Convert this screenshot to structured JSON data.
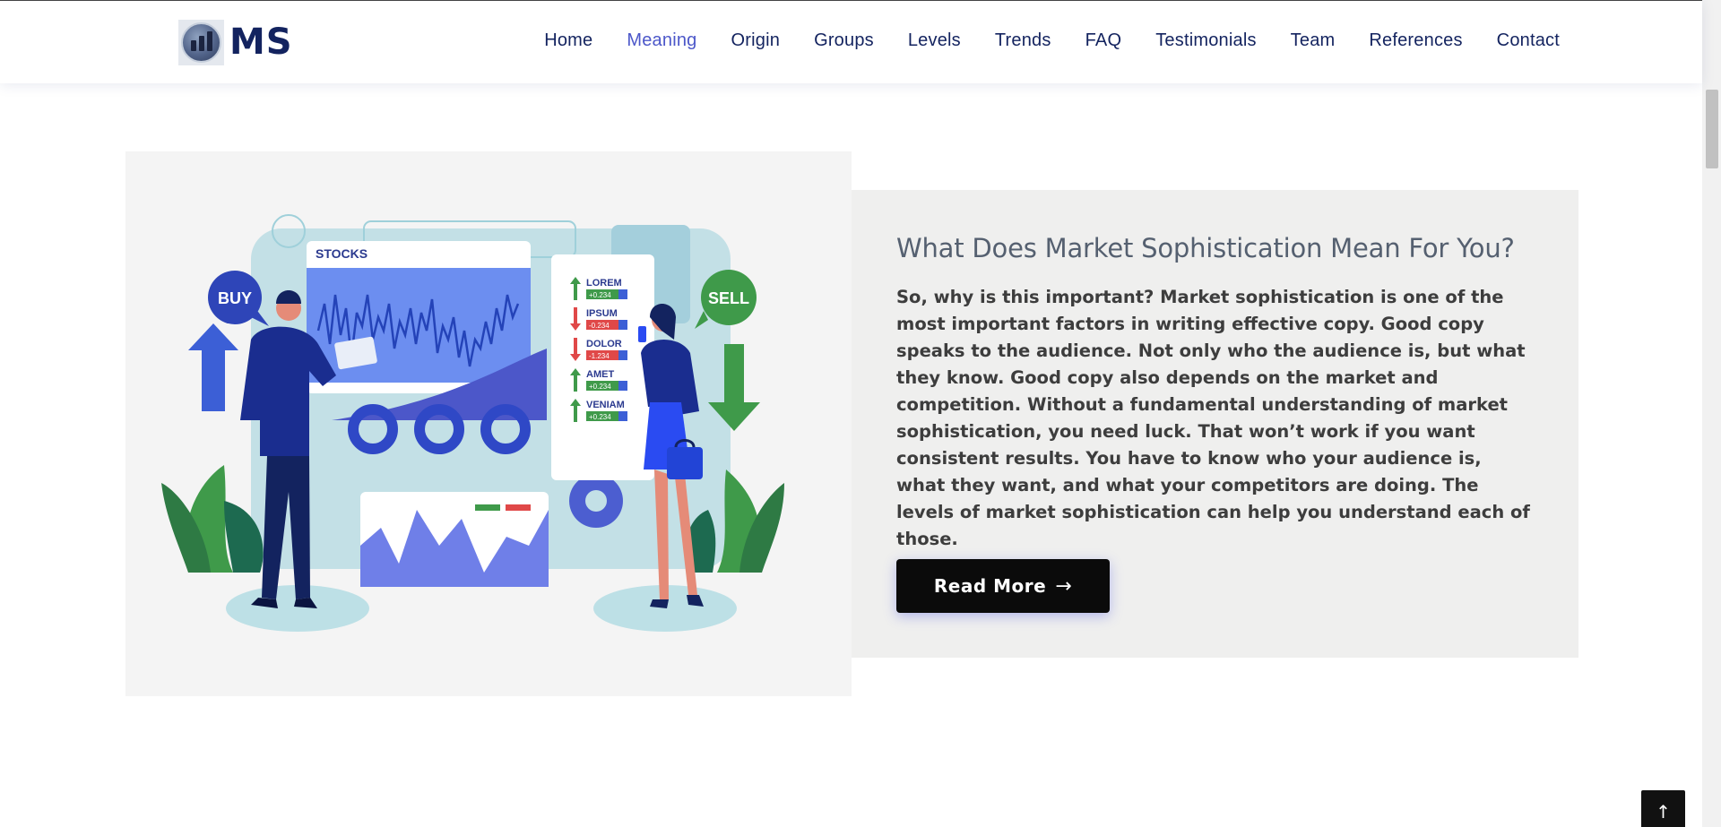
{
  "brand": {
    "logo_text": "MS"
  },
  "nav": {
    "items": [
      {
        "label": "Home",
        "active": false
      },
      {
        "label": "Meaning",
        "active": true
      },
      {
        "label": "Origin",
        "active": false
      },
      {
        "label": "Groups",
        "active": false
      },
      {
        "label": "Levels",
        "active": false
      },
      {
        "label": "Trends",
        "active": false
      },
      {
        "label": "FAQ",
        "active": false
      },
      {
        "label": "Testimonials",
        "active": false
      },
      {
        "label": "Team",
        "active": false
      },
      {
        "label": "References",
        "active": false
      },
      {
        "label": "Contact",
        "active": false
      }
    ]
  },
  "illustration": {
    "buy_label": "BUY",
    "sell_label": "SELL",
    "stocks_label": "STOCKS",
    "tickers": [
      {
        "name": "LOREM",
        "change": "+0.234",
        "direction": "up"
      },
      {
        "name": "IPSUM",
        "change": "-0.234",
        "direction": "down"
      },
      {
        "name": "DOLOR",
        "change": "-1.234",
        "direction": "down"
      },
      {
        "name": "AMET",
        "change": "+0.234",
        "direction": "up"
      },
      {
        "name": "VENIAM",
        "change": "+0.234",
        "direction": "up"
      }
    ]
  },
  "section": {
    "title": "What Does Market Sophistication Mean For You?",
    "body": "So, why is this important? Market sophistication is one of the most important factors in writing effective copy. Good copy speaks to the audience. Not only who the audience is, but what they know. Good copy also depends on the market and competition. Without a fundamental understanding of market sophistication, you need luck. That won’t work if you want consistent results. You have to know who your audience is, what they want, and what your competitors are doing. The levels of market sophistication can help you understand each of those.",
    "read_more_label": "Read More",
    "read_more_arrow": "→"
  },
  "back_to_top": {
    "icon": "arrow-up-icon",
    "glyph": "↑"
  },
  "colors": {
    "nav_text": "#13235f",
    "nav_active": "#4c57c9",
    "title": "#556070",
    "body_text": "#3d3d3d",
    "button_bg": "#0b0b0b"
  }
}
